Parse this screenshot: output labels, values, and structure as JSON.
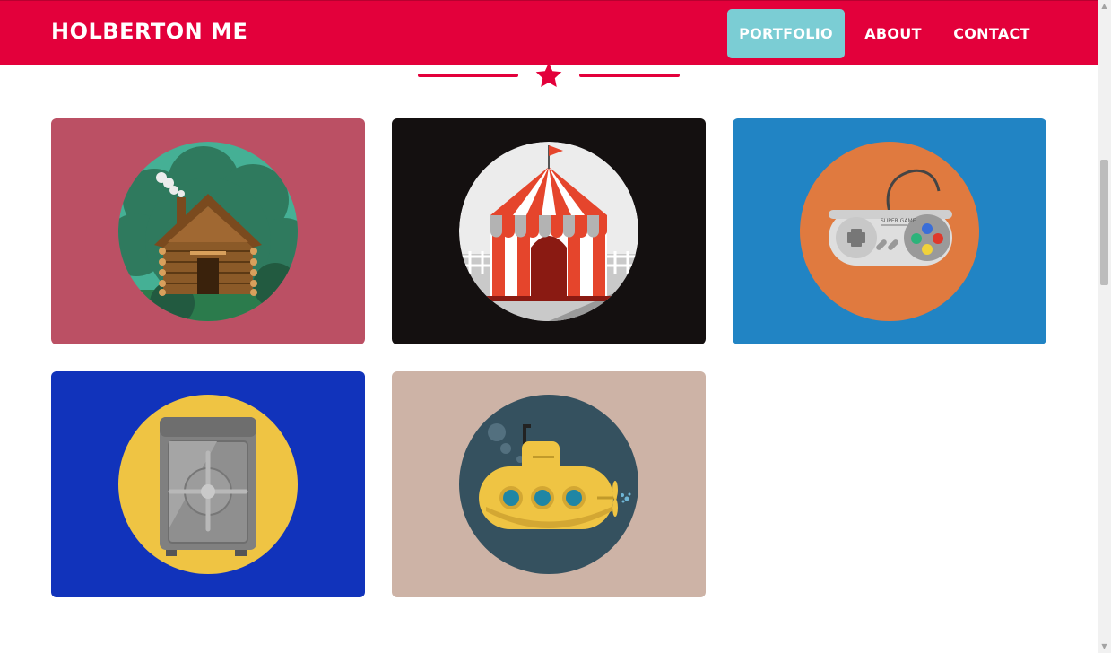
{
  "navbar": {
    "brand": "HOLBERTON ME",
    "items": [
      {
        "label": "PORTFOLIO",
        "active": true
      },
      {
        "label": "ABOUT",
        "active": false
      },
      {
        "label": "CONTACT",
        "active": false
      }
    ],
    "color": "#e3003b",
    "active_color": "#7bcdd4"
  },
  "divider": {
    "icon": "star-icon",
    "color": "#e3003b"
  },
  "portfolio": {
    "items": [
      {
        "name": "cabin",
        "icon": "cabin-icon",
        "bg": "#bb5064"
      },
      {
        "name": "circus",
        "icon": "circus-tent-icon",
        "bg": "#141010"
      },
      {
        "name": "game",
        "icon": "game-controller-icon",
        "bg": "#2184c4"
      },
      {
        "name": "safe",
        "icon": "safe-icon",
        "bg": "#1133bb"
      },
      {
        "name": "submarine",
        "icon": "submarine-icon",
        "bg": "#cdb3a6"
      }
    ]
  },
  "svg_text": {
    "controller_label": "SUPER GAME"
  }
}
